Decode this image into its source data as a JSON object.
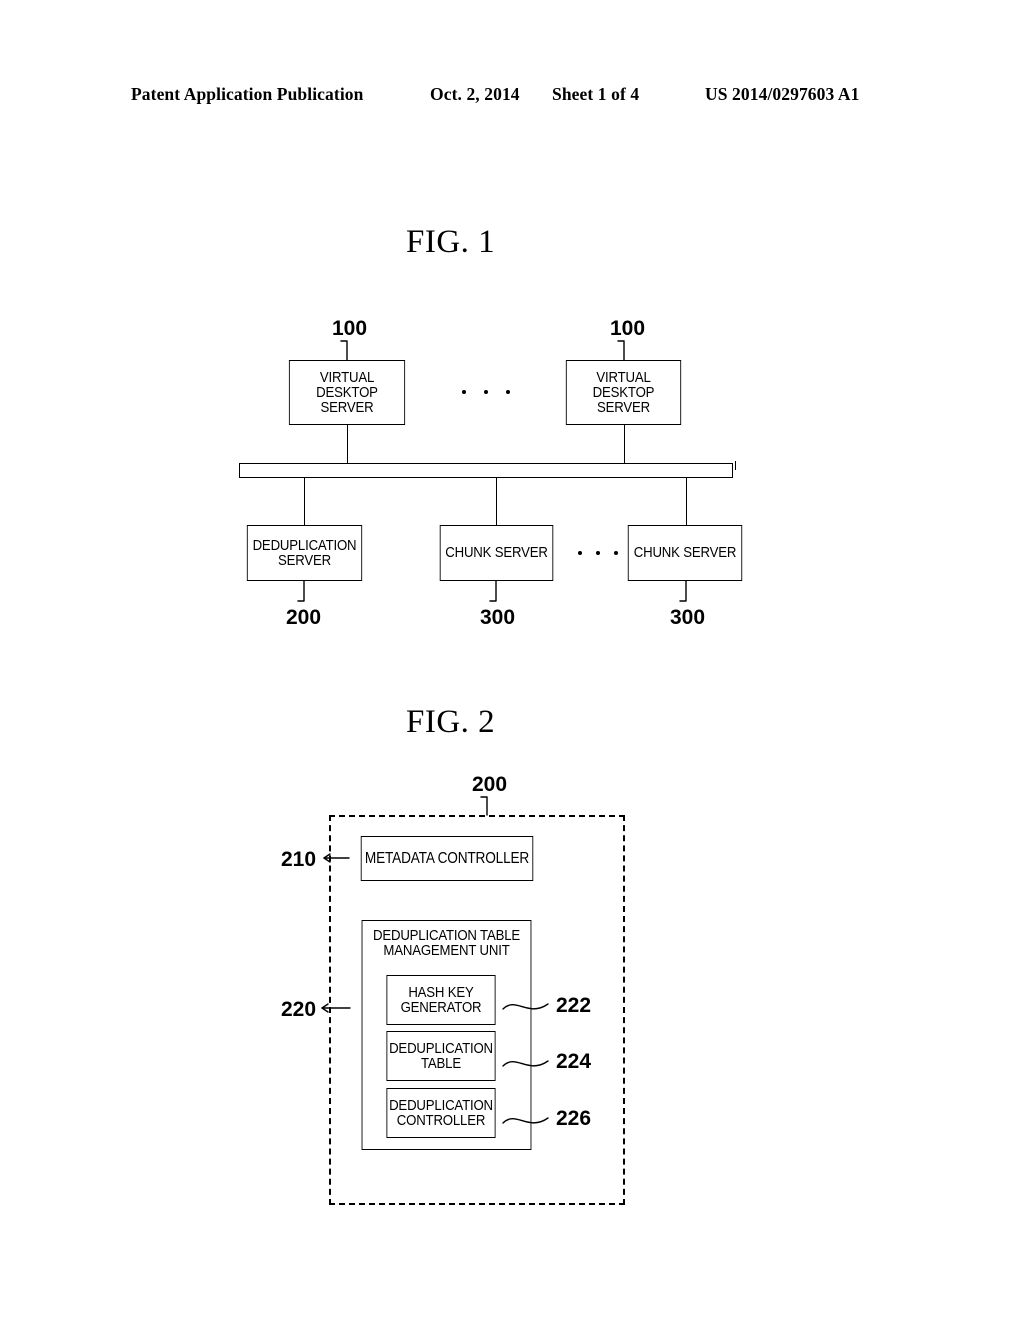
{
  "header": {
    "publication": "Patent Application Publication",
    "date": "Oct. 2, 2014",
    "sheet": "Sheet 1 of 4",
    "patent_number": "US 2014/0297603 A1"
  },
  "figures": [
    {
      "id": "fig1",
      "title": "FIG. 1",
      "nodes": [
        {
          "key": "vds_left",
          "label_line1": "VIRTUAL DESKTOP",
          "label_line2": "SERVER",
          "ref": "100"
        },
        {
          "key": "vds_right",
          "label_line1": "VIRTUAL DESKTOP",
          "label_line2": "SERVER",
          "ref": "100"
        },
        {
          "key": "dedup",
          "label_line1": "DEDUPLICATION",
          "label_line2": "SERVER",
          "ref": "200"
        },
        {
          "key": "chunk_left",
          "label_line1": "CHUNK SERVER",
          "label_line2": "",
          "ref": "300"
        },
        {
          "key": "chunk_right",
          "label_line1": "CHUNK SERVER",
          "label_line2": "",
          "ref": "300"
        }
      ],
      "ellipsis_count": 3
    },
    {
      "id": "fig2",
      "title": "FIG. 2",
      "boundary_ref": "200",
      "nodes": [
        {
          "key": "metadata_controller",
          "label_line1": "METADATA CONTROLLER",
          "label_line2": "",
          "ref": "210"
        },
        {
          "key": "dedup_table_mgmt",
          "label_line1": "DEDUPLICATION TABLE",
          "label_line2": "MANAGEMENT UNIT",
          "ref": "220"
        },
        {
          "key": "hash_key_generator",
          "label_line1": "HASH KEY",
          "label_line2": "GENERATOR",
          "ref": "222"
        },
        {
          "key": "deduplication_table",
          "label_line1": "DEDUPLICATION",
          "label_line2": "TABLE",
          "ref": "224"
        },
        {
          "key": "dedup_controller",
          "label_line1": "DEDUPLICATION",
          "label_line2": "CONTROLLER",
          "ref": "226"
        }
      ]
    }
  ],
  "colors": {
    "ink": "#000000",
    "paper": "#ffffff"
  }
}
